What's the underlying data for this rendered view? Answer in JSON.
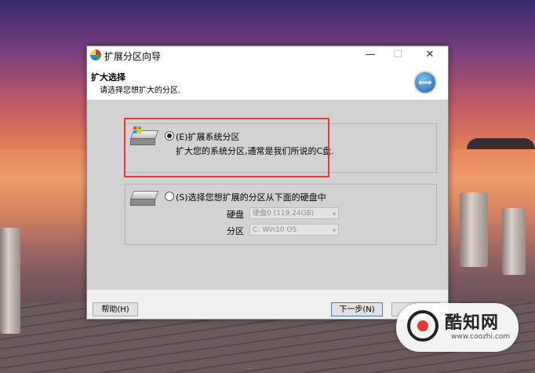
{
  "window": {
    "title": "扩展分区向导",
    "minimize_glyph": "—",
    "maximize_glyph": "☐",
    "close_glyph": "✕"
  },
  "header": {
    "title": "扩大选择",
    "subtitle": "请选择您想扩大的分区.",
    "icon": "expand-arrows-icon",
    "icon_glyph": "⟺"
  },
  "options": [
    {
      "label": "(E)扩展系统分区",
      "description": "扩大您的系统分区,通常是我们所说的C盘.",
      "checked": true
    },
    {
      "label": "(S)选择您想扩展的分区从下面的硬盘中",
      "checked": false,
      "disk_label": "硬盘",
      "disk_value": "硬盘0 (119.24GB)",
      "partition_label": "分区",
      "partition_value": "C: Win10 OS"
    }
  ],
  "footer": {
    "help_label": "帮助(H)",
    "next_label": "下一步(N)"
  },
  "watermark": {
    "name": "酷知网",
    "url": "www.coozhi.com"
  },
  "colors": {
    "highlight": "#e53935",
    "dialog_body": "#d2d2d2"
  }
}
